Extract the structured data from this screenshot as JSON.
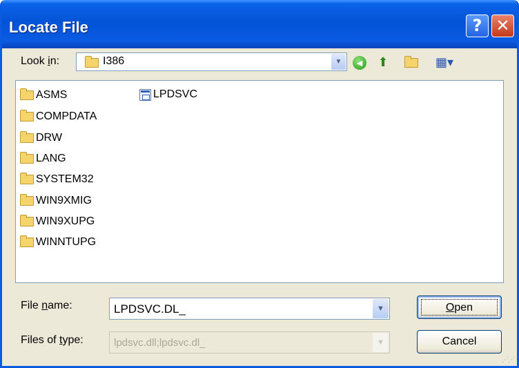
{
  "dialog": {
    "title": "Locate File",
    "help_glyph": "?",
    "close_glyph": "✕"
  },
  "lookin": {
    "label_prefix": "Look ",
    "label_accel": "i",
    "label_suffix": "n:",
    "value": "I386",
    "icons": [
      "folder-icon",
      "back-icon",
      "up-one-level-icon",
      "new-folder-icon",
      "views-menu-icon"
    ]
  },
  "files": {
    "folders": [
      "ASMS",
      "COMPDATA",
      "DRW",
      "LANG",
      "SYSTEM32",
      "WIN9XMIG",
      "WIN9XUPG",
      "WINNTUPG"
    ],
    "documents": [
      "LPDSVC"
    ]
  },
  "filename": {
    "label_prefix": "File ",
    "label_accel": "n",
    "label_suffix": "ame:",
    "value": "LPDSVC.DL_"
  },
  "filetype": {
    "label_prefix": "Files of ",
    "label_accel": "t",
    "label_suffix": "ype:",
    "value": "lpdsvc.dll;lpdsvc.dl_"
  },
  "buttons": {
    "open_accel": "O",
    "open_rest": "pen",
    "cancel": "Cancel"
  },
  "colors": {
    "titlebar": "#0453d6",
    "dialog_bg": "#ece9d8",
    "close_button": "#c5391b"
  }
}
